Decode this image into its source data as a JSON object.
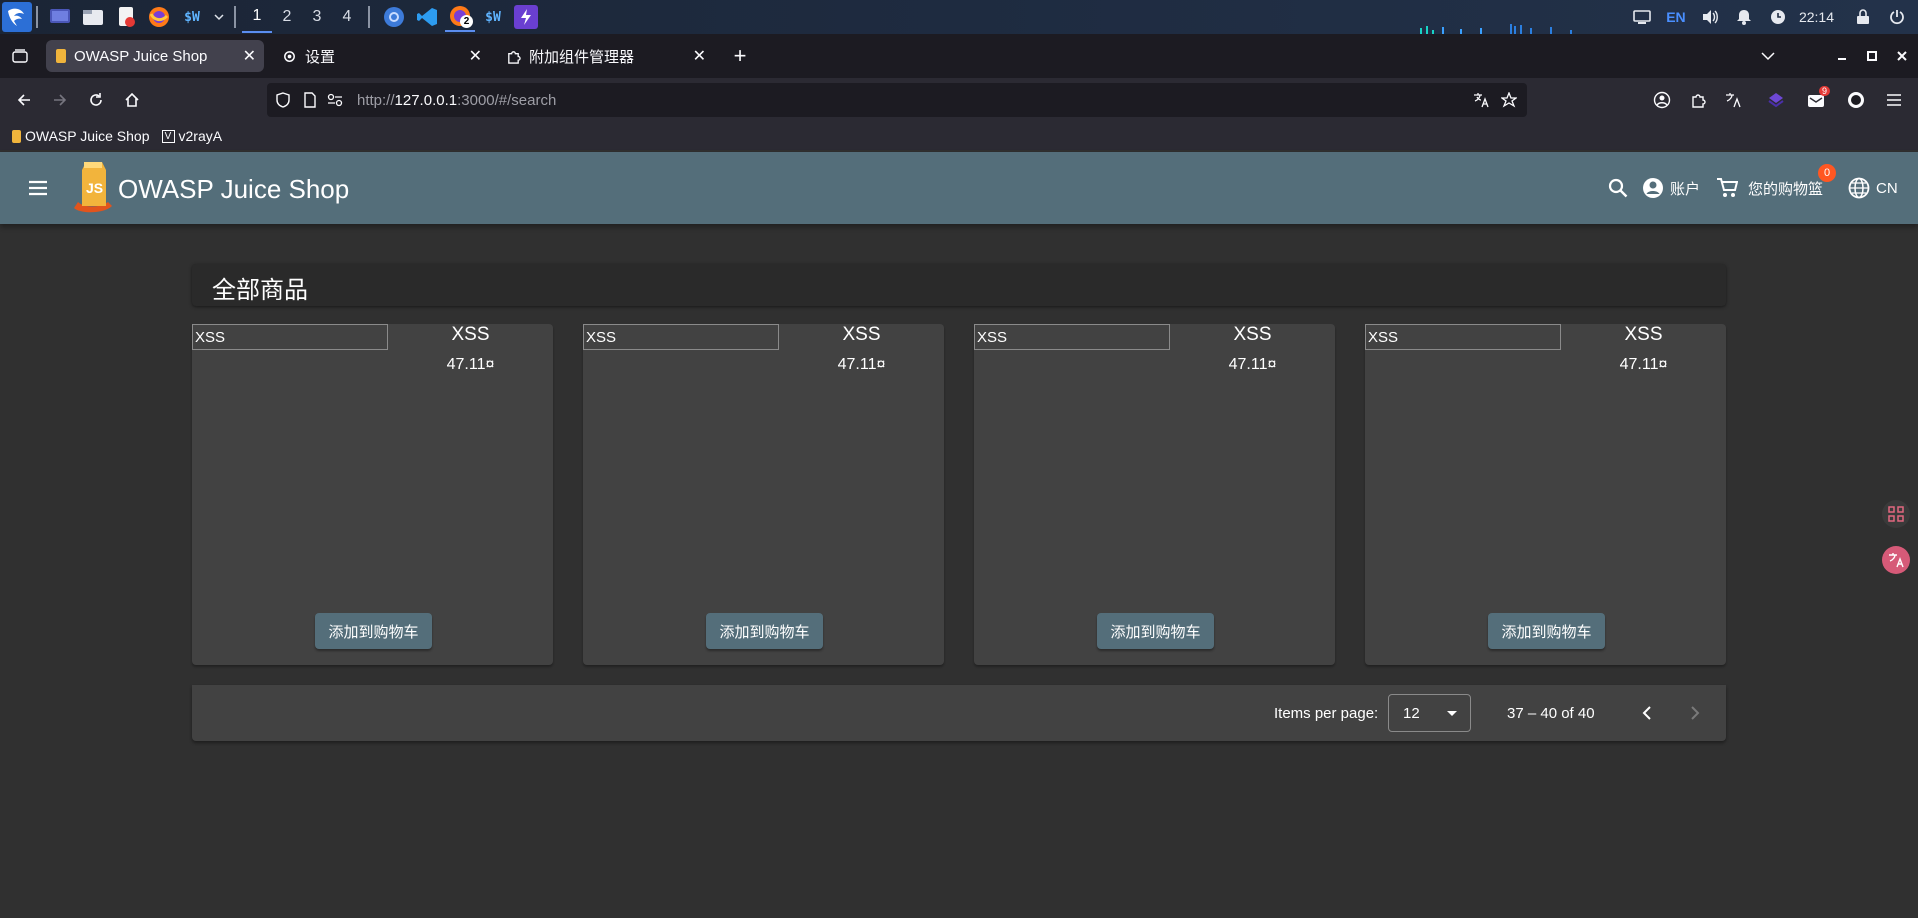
{
  "taskbar": {
    "workspaces": [
      "1",
      "2",
      "3",
      "4"
    ],
    "active_workspace": "1",
    "task_badge": "2",
    "app_label_a": "$W",
    "app_label_b": "$W",
    "lang": "EN",
    "clock": "22:14"
  },
  "browser": {
    "tabs": [
      {
        "label": "OWASP Juice Shop"
      },
      {
        "label": "设置"
      },
      {
        "label": "附加组件管理器"
      }
    ],
    "url_scheme": "http://",
    "url_host": "127.0.0.1",
    "url_rest": ":3000/#/search",
    "extension_badge": "9",
    "bookmarks": [
      {
        "label": "OWASP Juice Shop"
      },
      {
        "label": "v2rayA"
      }
    ]
  },
  "app": {
    "title": "OWASP Juice Shop",
    "logo_text": "JS",
    "account_label": "账户",
    "cart_label": "您的购物篮",
    "cart_count": "0",
    "language_label": "CN"
  },
  "main": {
    "heading": "全部商品",
    "products": [
      {
        "image_alt": "XSS",
        "name": "XSS",
        "price": "47.11¤",
        "button": "添加到购物车"
      },
      {
        "image_alt": "XSS",
        "name": "XSS",
        "price": "47.11¤",
        "button": "添加到购物车"
      },
      {
        "image_alt": "XSS",
        "name": "XSS",
        "price": "47.11¤",
        "button": "添加到购物车"
      },
      {
        "image_alt": "XSS",
        "name": "XSS",
        "price": "47.11¤",
        "button": "添加到购物车"
      }
    ]
  },
  "paginator": {
    "items_per_page_label": "Items per page:",
    "items_per_page_value": "12",
    "range_label": "37 – 40 of 40"
  },
  "colors": {
    "toolbar": "#546e7a",
    "background": "#303030",
    "card": "#424242",
    "badge": "#ff5722"
  }
}
